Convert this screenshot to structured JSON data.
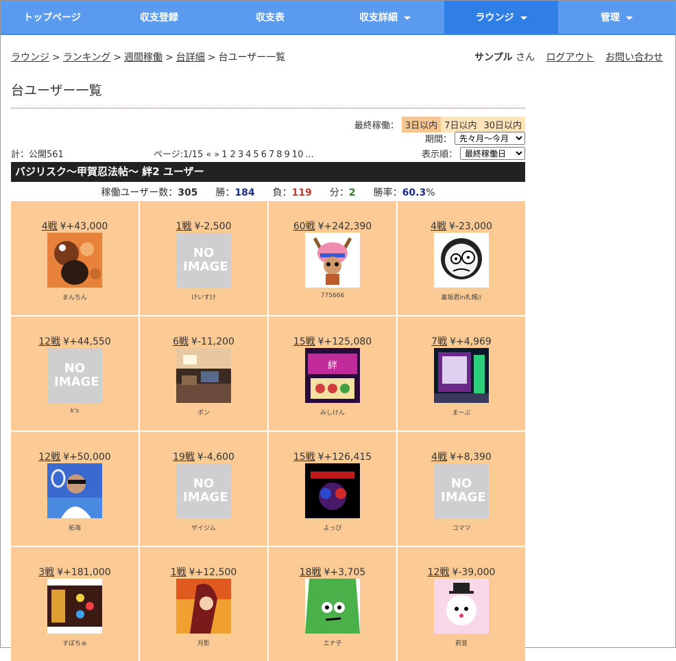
{
  "nav": [
    {
      "label": "トップページ",
      "caret": false,
      "active": false,
      "width": 150
    },
    {
      "label": "収支登録",
      "caret": false,
      "active": false,
      "width": 162
    },
    {
      "label": "収支表",
      "caret": false,
      "active": false,
      "width": 162
    },
    {
      "label": "収支詳細",
      "caret": true,
      "active": false,
      "width": 173
    },
    {
      "label": "ラウンジ",
      "caret": true,
      "active": true,
      "width": 166
    },
    {
      "label": "管理",
      "caret": true,
      "active": false,
      "width": 171
    }
  ],
  "breadcrumb": {
    "items": [
      "ラウンジ",
      "ランキング",
      "週間稼働",
      "台詳細"
    ],
    "current": "台ユーザー一覧",
    "sep": ">"
  },
  "user": {
    "name": "サンプル",
    "suffix": "さん",
    "logout": "ログアウト",
    "contact": "お問い合わせ"
  },
  "page_title": "台ユーザー一覧",
  "filters": {
    "last_active_label": "最終稼働：",
    "periods": [
      "3日以内",
      "7日以内",
      "30日以内"
    ],
    "selected_period": "3日以内",
    "term_label": "期間：",
    "term_value": "先々月～今月",
    "sort_label": "表示順：",
    "sort_value": "最終稼働日"
  },
  "total": "計：公開561",
  "pager": {
    "label": "ページ:1/15",
    "prev": "«",
    "next": "»",
    "pages": [
      "1",
      "2",
      "3",
      "4",
      "5",
      "6",
      "7",
      "8",
      "9",
      "10"
    ],
    "more": "..."
  },
  "section_title": "バジリスク～甲賀忍法帖～ 絆2 ユーザー",
  "stats": {
    "users_label": "稼働ユーザー数：",
    "users": "305",
    "win_label": "勝：",
    "win": "184",
    "lose_label": "負：",
    "lose": "119",
    "draw_label": "分：",
    "draw": "2",
    "rate_label": "勝率：",
    "rate": "60.3",
    "rate_unit": "%"
  },
  "no_image_text": "NO IMAGE",
  "users": [
    {
      "games": "4戦",
      "yen": "¥+43,000",
      "sign": "pos",
      "name": "まんちん",
      "img": "bear"
    },
    {
      "games": "1戦",
      "yen": "¥-2,500",
      "sign": "neg",
      "name": "けいすけ",
      "img": "none"
    },
    {
      "games": "60戦",
      "yen": "¥+242,390",
      "sign": "pos",
      "name": "775666",
      "img": "chopper"
    },
    {
      "games": "4戦",
      "yen": "¥-23,000",
      "sign": "neg",
      "name": "裏垢君in札幌//",
      "img": "sketch"
    },
    {
      "games": "12戦",
      "yen": "¥+44,550",
      "sign": "pos",
      "name": "k's",
      "img": "none"
    },
    {
      "games": "6戦",
      "yen": "¥-11,200",
      "sign": "neg",
      "name": "ポン",
      "img": "room"
    },
    {
      "games": "15戦",
      "yen": "¥+125,080",
      "sign": "pos",
      "name": "みしけん",
      "img": "slot"
    },
    {
      "games": "7戦",
      "yen": "¥+4,969",
      "sign": "pos",
      "name": "まーぶ",
      "img": "machine"
    },
    {
      "games": "12戦",
      "yen": "¥+50,000",
      "sign": "pos",
      "name": "拓海",
      "img": "tennis"
    },
    {
      "games": "19戦",
      "yen": "¥-4,600",
      "sign": "neg",
      "name": "ザイジム",
      "img": "none"
    },
    {
      "games": "15戦",
      "yen": "¥+126,415",
      "sign": "pos",
      "name": "よっぴ",
      "img": "dark"
    },
    {
      "games": "4戦",
      "yen": "¥+8,390",
      "sign": "pos",
      "name": "コマツ",
      "img": "none"
    },
    {
      "games": "3戦",
      "yen": "¥+181,000",
      "sign": "pos",
      "name": "すぽちゅ",
      "img": "slot2"
    },
    {
      "games": "1戦",
      "yen": "¥+12,500",
      "sign": "pos",
      "name": "月影",
      "img": "anime"
    },
    {
      "games": "18戦",
      "yen": "¥+3,705",
      "sign": "pos",
      "name": "エナ子",
      "img": "green"
    },
    {
      "games": "12戦",
      "yen": "¥-39,000",
      "sign": "neg",
      "name": "莉音",
      "img": "mascot"
    }
  ]
}
